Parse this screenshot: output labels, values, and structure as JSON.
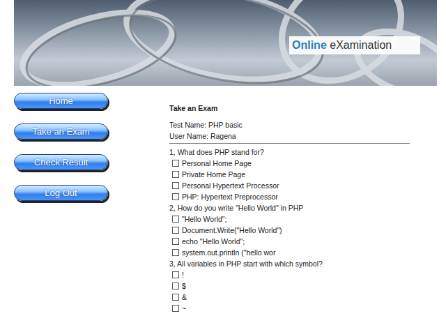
{
  "header": {
    "logo_part1": "Online",
    "logo_part2": "eXamination"
  },
  "sidebar": {
    "items": [
      "Home",
      "Take an Exam",
      "Check Result",
      "Log Out"
    ]
  },
  "exam": {
    "title": "Take an Exam",
    "test_name": "Test Name: PHP basic",
    "user_name": "User Name: Ragena",
    "questions": [
      {
        "text": "1, What does PHP stand for?",
        "options": [
          {
            "label": "Personal Home Page",
            "checked": false
          },
          {
            "label": "Private Home Page",
            "checked": false
          },
          {
            "label": "Personal Hypertext Processor",
            "checked": false
          },
          {
            "label": "PHP: Hypertext Preprocessor",
            "checked": false
          }
        ]
      },
      {
        "text": "2, How do you write \"Hello World\" in PHP",
        "options": [
          {
            "label": "\"Hello World\";",
            "checked": false
          },
          {
            "label": "Document.Write(\"Hello World\")",
            "checked": false
          },
          {
            "label": "echo \"Hello World\";",
            "checked": false
          },
          {
            "label": "system.out.println (\"hello wor",
            "checked": false
          }
        ]
      },
      {
        "text": "3, All variables in PHP start with which symbol?",
        "options": [
          {
            "label": "!",
            "checked": false
          },
          {
            "label": "$",
            "checked": false
          },
          {
            "label": "&",
            "checked": false
          },
          {
            "label": "~",
            "checked": false
          }
        ]
      }
    ]
  }
}
